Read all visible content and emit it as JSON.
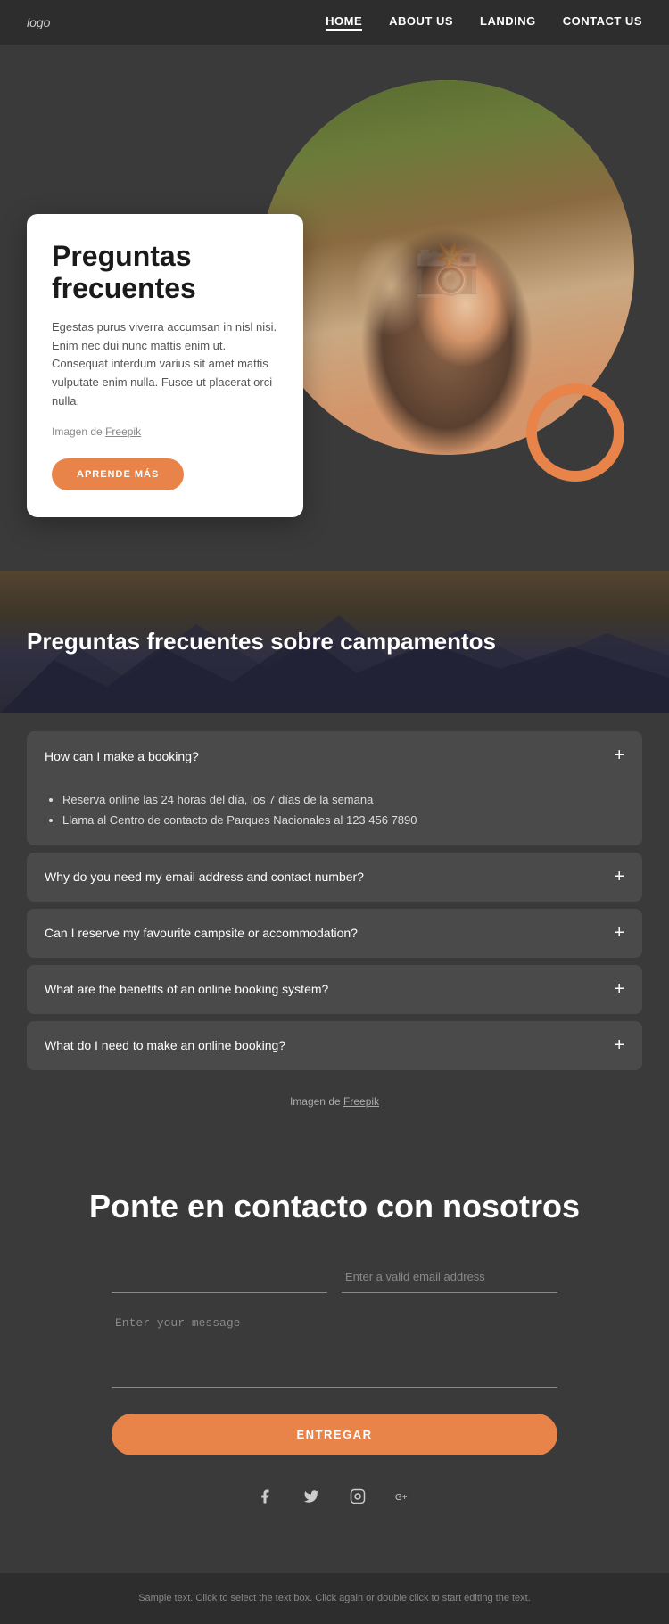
{
  "nav": {
    "logo": "logo",
    "links": [
      {
        "label": "HOME",
        "active": true
      },
      {
        "label": "ABOUT US",
        "active": false
      },
      {
        "label": "LANDING",
        "active": false
      },
      {
        "label": "CONTACT US",
        "active": false
      }
    ]
  },
  "hero": {
    "title": "Preguntas frecuentes",
    "body": "Egestas purus viverra accumsan in nisl nisi. Enim nec dui nunc mattis enim ut. Consequat interdum varius sit amet mattis vulputate enim nulla. Fusce ut placerat orci nulla.",
    "image_credit_prefix": "Imagen de",
    "image_credit_link": "Freepik",
    "learn_more_label": "APRENDE MÁS"
  },
  "faq_banner": {
    "title": "Preguntas frecuentes sobre campamentos"
  },
  "faq": {
    "items": [
      {
        "question": "How can I make a booking?",
        "open": true,
        "answers": [
          "Reserva online las 24 horas del día, los 7 días de la semana",
          "Llama al Centro de contacto de Parques Nacionales al 123 456 7890"
        ]
      },
      {
        "question": "Why do you need my email address and contact number?",
        "open": false,
        "answers": []
      },
      {
        "question": "Can I reserve my favourite campsite or accommodation?",
        "open": false,
        "answers": []
      },
      {
        "question": "What are the benefits of an online booking system?",
        "open": false,
        "answers": []
      },
      {
        "question": "What do I need to make an online booking?",
        "open": false,
        "answers": []
      }
    ],
    "image_credit_prefix": "Imagen de",
    "image_credit_link": "Freepik"
  },
  "contact": {
    "title": "Ponte en contacto con nosotros",
    "name_placeholder": "",
    "email_placeholder": "Enter a valid email address",
    "message_placeholder": "Enter your message",
    "submit_label": "ENTREGAR"
  },
  "social": {
    "icons": [
      "f",
      "t",
      "ig",
      "g+"
    ]
  },
  "footer": {
    "text": "Sample text. Click to select the text box. Click again or double click to start editing the text."
  }
}
